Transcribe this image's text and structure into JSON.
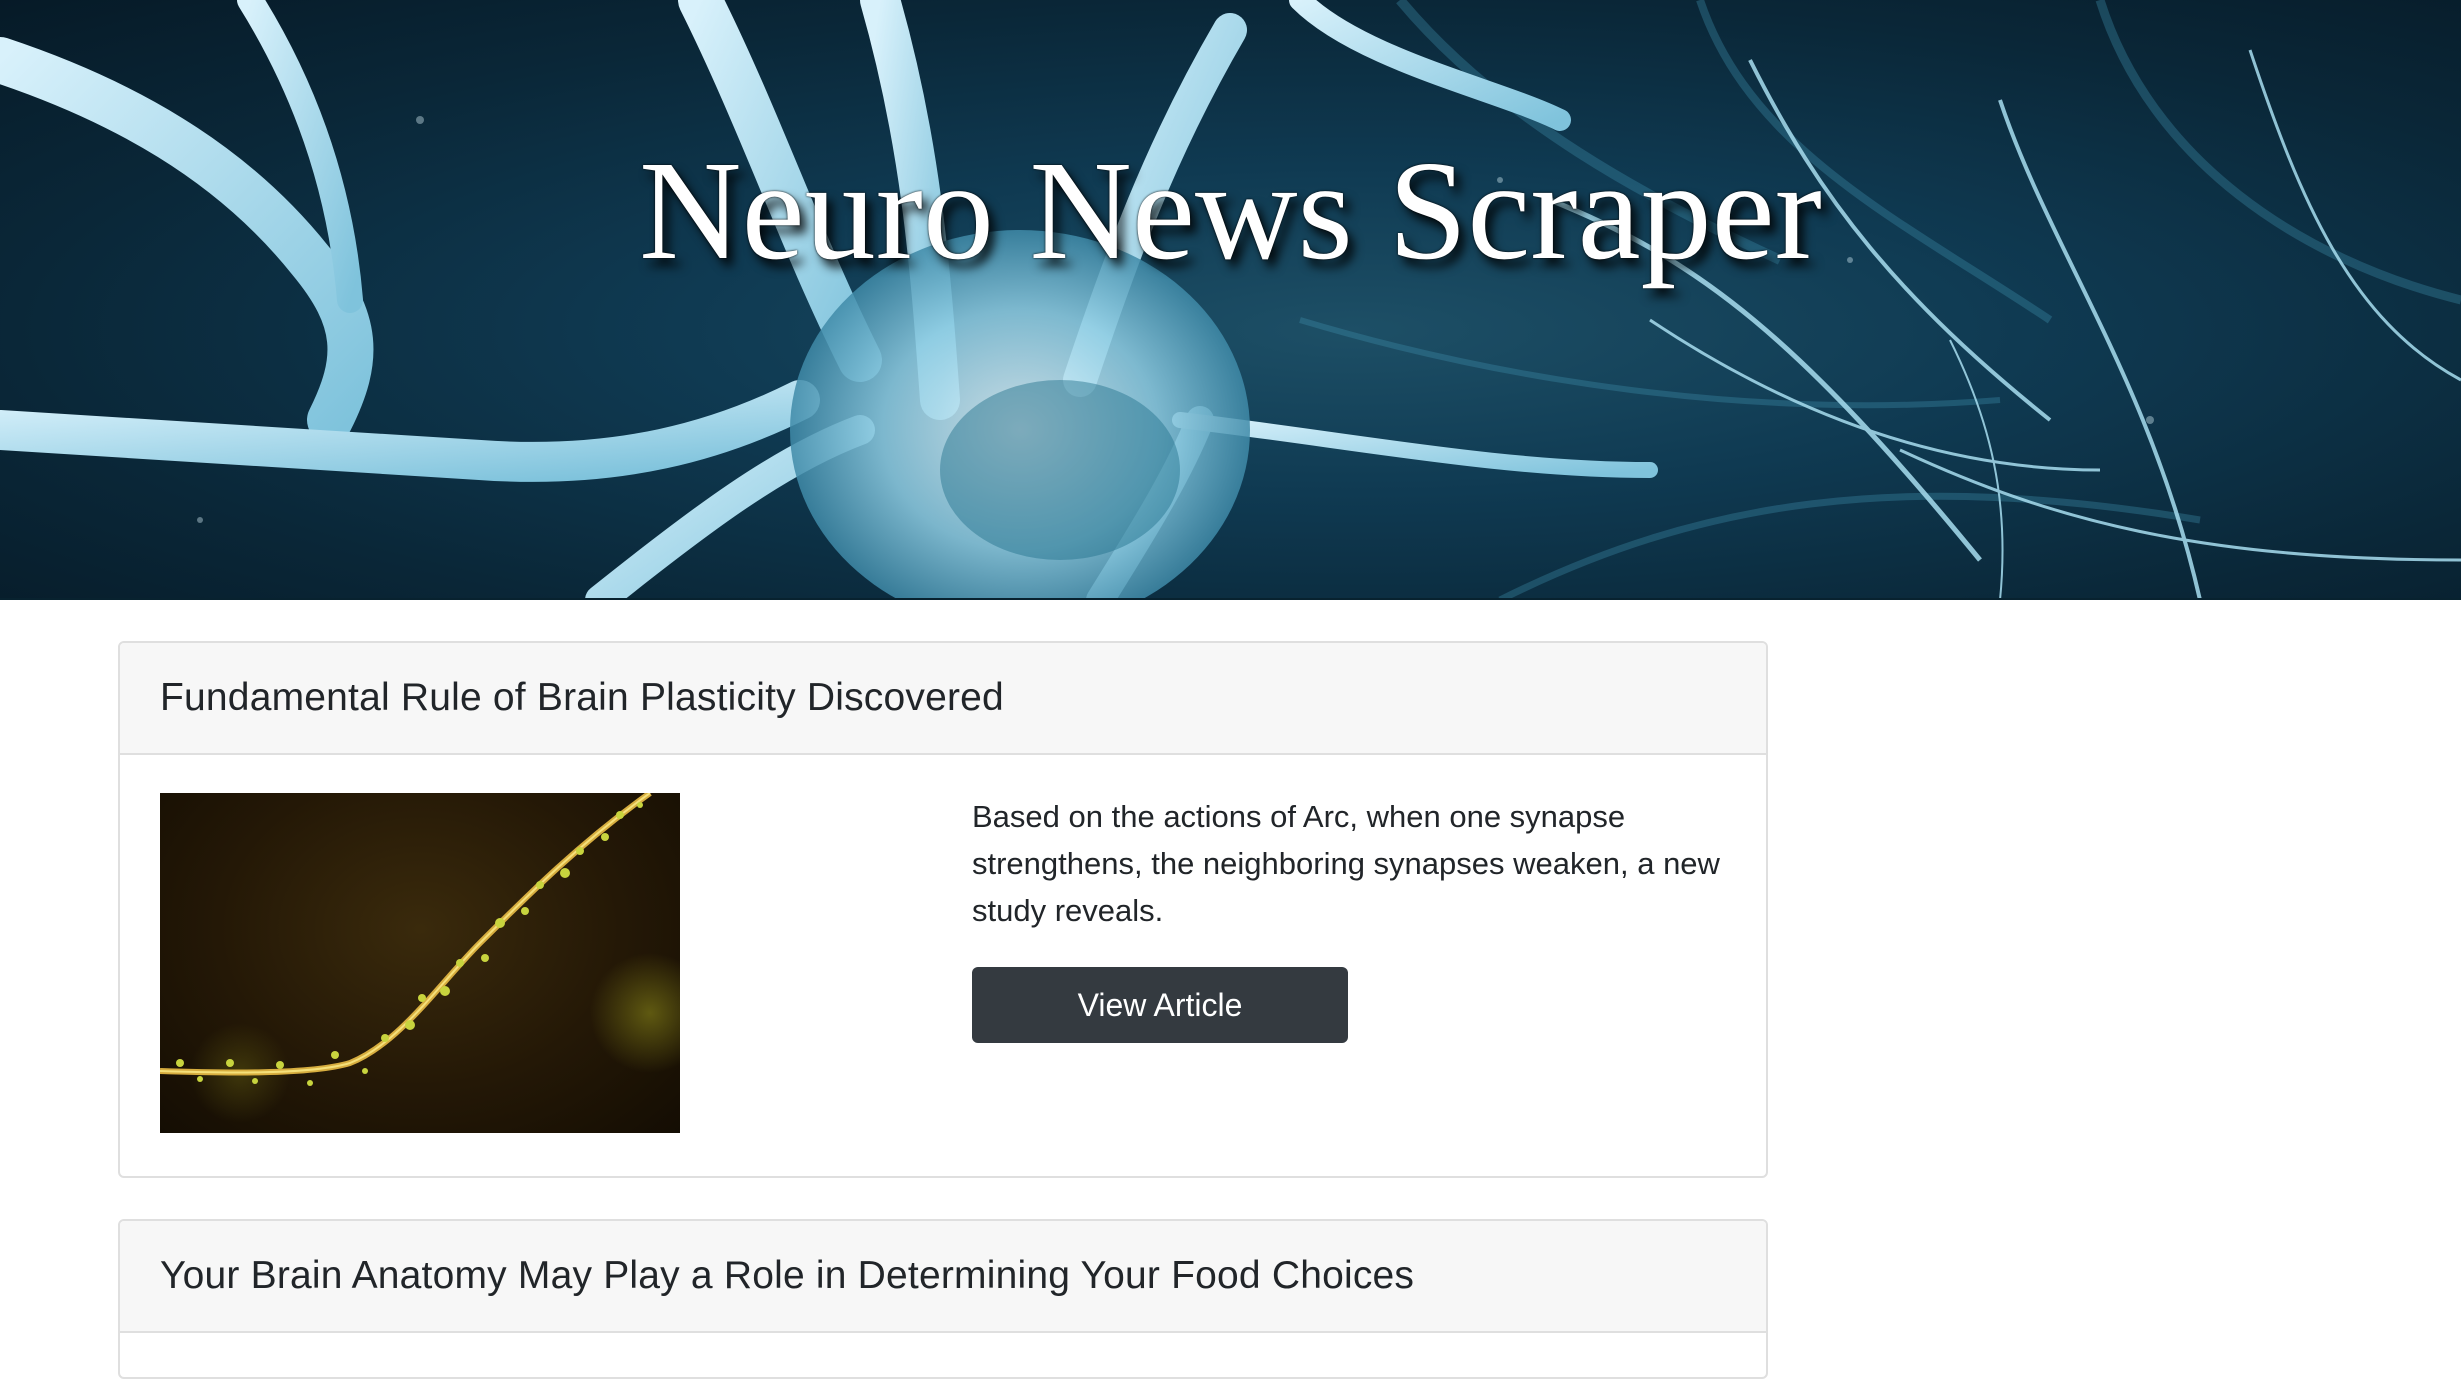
{
  "header": {
    "title": "Neuro News Scraper"
  },
  "articles": [
    {
      "title": "Fundamental Rule of Brain Plasticity Discovered",
      "summary": "Based on the actions of Arc, when one synapse strengthens, the neighboring synapses weaken, a new study reveals.",
      "button_label": "View Article"
    },
    {
      "title": "Your Brain Anatomy May Play a Role in Determining Your Food Choices"
    }
  ],
  "colors": {
    "button_bg": "#343a40",
    "card_header_bg": "#f7f7f7",
    "card_border": "#dfdfdf",
    "hero_bg": "#0f3a52"
  }
}
